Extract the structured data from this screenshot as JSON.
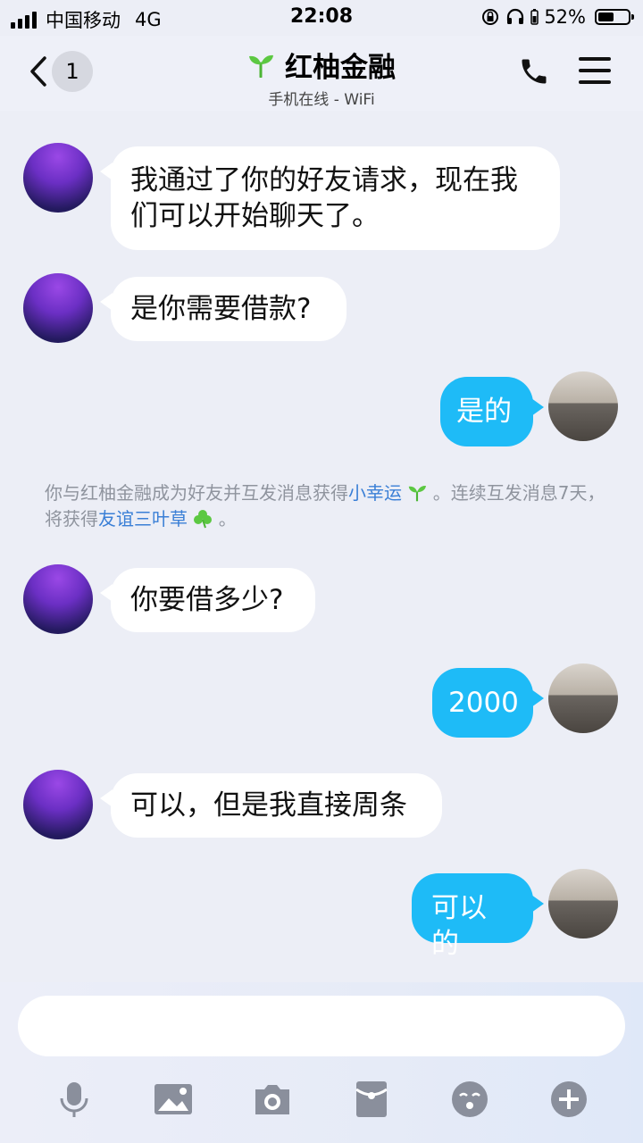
{
  "status_bar": {
    "carrier": "中国移动",
    "network": "4G",
    "time": "22:08",
    "battery": "52%",
    "battery_level": 0.52
  },
  "header": {
    "unread_count": "1",
    "title": "红柚金融",
    "subtitle": "手机在线 - WiFi"
  },
  "messages": [
    {
      "from": "them",
      "text": "我通过了你的好友请求，现在我们可以开始聊天了。"
    },
    {
      "from": "them",
      "text": "是你需要借款?"
    },
    {
      "from": "me",
      "text": "是的"
    },
    {
      "from": "them",
      "text": "你要借多少?"
    },
    {
      "from": "me",
      "text": "2000"
    },
    {
      "from": "them",
      "text": "可以，但是我直接周条"
    },
    {
      "from": "me",
      "text": "可以的"
    }
  ],
  "system_message": {
    "part1": "你与红柚金融成为好友并互发消息获得",
    "link1": "小幸运",
    "part2": "。连续互发消息7天，将获得",
    "link2": "友谊三叶草",
    "part3": "。"
  },
  "toolbar_icons": [
    "microphone-icon",
    "image-icon",
    "camera-icon",
    "red-packet-icon",
    "emoji-icon",
    "plus-icon"
  ],
  "colors": {
    "background": "#eceef6",
    "outgoing_bubble": "#1ebbf7",
    "incoming_bubble": "#ffffff",
    "link": "#3a7fd6",
    "icon_gray": "#8a8f9c"
  }
}
